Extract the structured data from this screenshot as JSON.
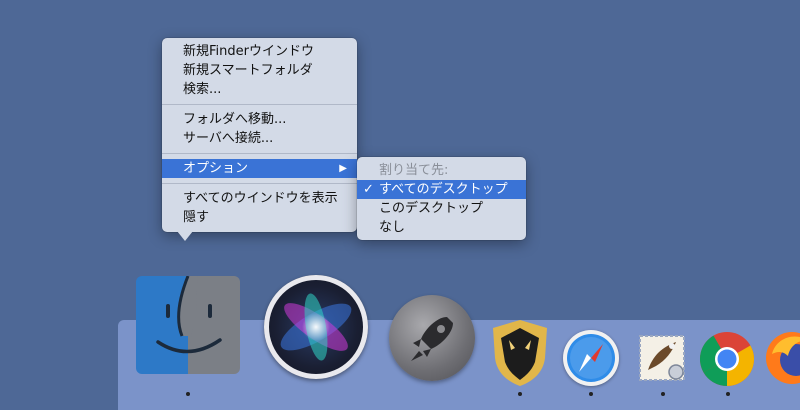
{
  "context_menu": {
    "items": [
      "新規Finderウインドウ",
      "新規スマートフォルダ",
      "検索...",
      "フォルダへ移動...",
      "サーバへ接続...",
      "オプション",
      "すべてのウインドウを表示",
      "隠す"
    ],
    "highlighted": "オプション",
    "submenu_arrow": "▶"
  },
  "options_submenu": {
    "header": "割り当て先:",
    "items": [
      "すべてのデスクトップ",
      "このデスクトップ",
      "なし"
    ],
    "checked": "すべてのデスクトップ",
    "check_glyph": "✓"
  },
  "dock": {
    "apps": [
      {
        "name": "Finder",
        "icon": "finder-icon",
        "running": true
      },
      {
        "name": "Siri",
        "icon": "siri-icon",
        "running": false
      },
      {
        "name": "Launchpad",
        "icon": "launchpad-icon",
        "running": false
      },
      {
        "name": "Unknown shield app",
        "icon": "dragon-shield-icon",
        "running": true
      },
      {
        "name": "Safari",
        "icon": "safari-icon",
        "running": true
      },
      {
        "name": "Mail",
        "icon": "mail-icon",
        "running": true
      },
      {
        "name": "Google Chrome",
        "icon": "chrome-icon",
        "running": true
      },
      {
        "name": "Firefox",
        "icon": "firefox-icon",
        "running": false
      }
    ]
  },
  "colors": {
    "desktop": "#4e6896",
    "menu_bg": "#d3dae7",
    "highlight": "#3a73d6",
    "dock_bg": "#7b93c9"
  }
}
